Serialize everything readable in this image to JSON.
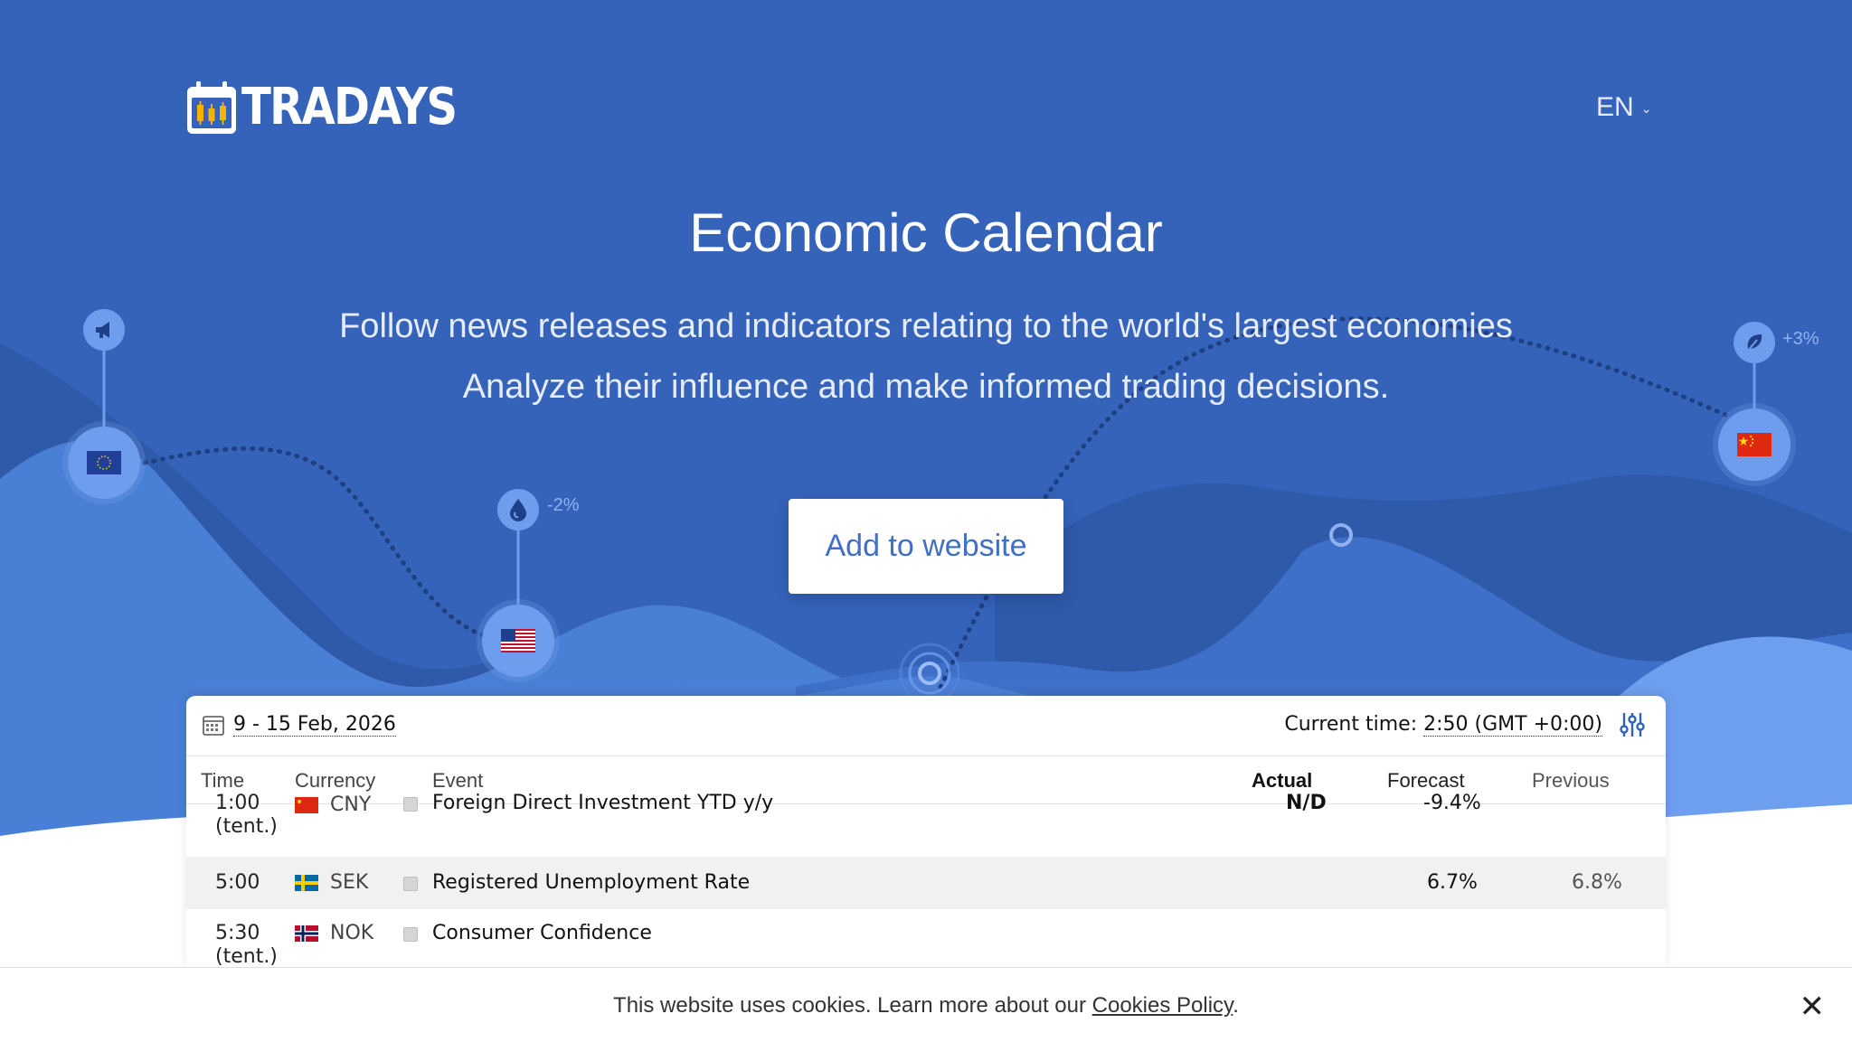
{
  "brand": {
    "name": "TRADAYS"
  },
  "header": {
    "language": "EN"
  },
  "hero": {
    "title": "Economic Calendar",
    "subtitle_line1": "Follow news releases and indicators relating to the world's largest economies",
    "subtitle_line2": "Analyze their influence and make informed trading decisions.",
    "cta_label": "Add to website",
    "badges": {
      "left": "-2%",
      "right": "+3%"
    }
  },
  "widget": {
    "date_range": "9 - 15 Feb, 2026",
    "current_time_label": "Current time:",
    "current_time_value": "2:50 (GMT +0:00)",
    "columns": {
      "time": "Time",
      "currency": "Currency",
      "event": "Event",
      "actual": "Actual",
      "forecast": "Forecast",
      "previous": "Previous"
    },
    "rows": [
      {
        "time": "1:00",
        "time_note": "(tent.)",
        "currency": "CNY",
        "event": "Foreign Direct Investment YTD y/y",
        "actual": "N/D",
        "forecast": "-9.4%",
        "previous": ""
      },
      {
        "time": "5:00",
        "time_note": "",
        "currency": "SEK",
        "event": "Registered Unemployment Rate",
        "actual": "",
        "forecast": "6.7%",
        "previous": "6.8%"
      },
      {
        "time": "5:30",
        "time_note": "(tent.)",
        "currency": "NOK",
        "event": "Consumer Confidence",
        "actual": "",
        "forecast": "",
        "previous": ""
      }
    ]
  },
  "cookie": {
    "text": "This website uses cookies. Learn more about our ",
    "link": "Cookies Policy",
    "suffix": "."
  },
  "colors": {
    "hero_bg": "#3563ba",
    "accent": "#6f9ded",
    "cta_text": "#3f6fc6"
  }
}
